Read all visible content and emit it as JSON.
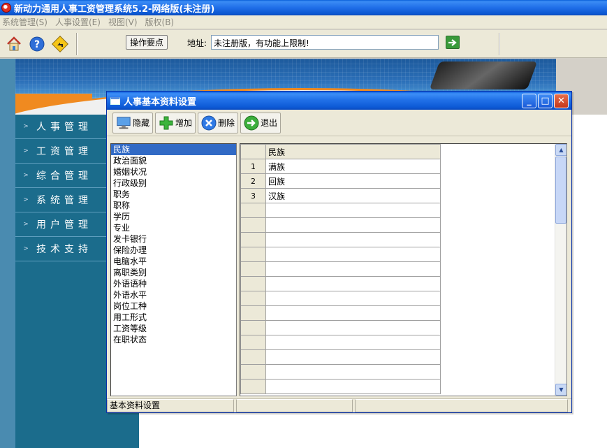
{
  "app": {
    "title": "新动力通用人事工资管理系统5.2-网络版(未注册)"
  },
  "menubar": {
    "items": [
      {
        "label": "系统管理(S)"
      },
      {
        "label": "人事设置(E)"
      },
      {
        "label": "视图(V)"
      },
      {
        "label": "版权(B)"
      }
    ]
  },
  "toolbar": {
    "tips_button": "操作要点",
    "address_label": "地址:",
    "address_value": "未注册版，有功能上限制!",
    "icons": [
      "home-icon",
      "help-icon",
      "navigate-icon",
      "go-arrow-icon"
    ]
  },
  "nav": {
    "items": [
      {
        "label": "人事管理"
      },
      {
        "label": "工资管理"
      },
      {
        "label": "综合管理"
      },
      {
        "label": "系统管理"
      },
      {
        "label": "用户管理"
      },
      {
        "label": "技术支持"
      }
    ]
  },
  "dialog": {
    "title": "人事基本资料设置",
    "buttons": {
      "hide": "隐藏",
      "add": "增加",
      "delete": "删除",
      "exit": "退出"
    },
    "categories": [
      "民族",
      "政治面貌",
      "婚姻状况",
      "行政级别",
      "职务",
      "职称",
      "学历",
      "专业",
      "发卡银行",
      "保险办理",
      "电脑水平",
      "离职类别",
      "外语语种",
      "外语水平",
      "岗位工种",
      "用工形式",
      "工资等级",
      "在职状态"
    ],
    "selected_category": "民族",
    "grid": {
      "column_header": "民族",
      "rows": [
        {
          "num": "1",
          "value": "满族"
        },
        {
          "num": "2",
          "value": "回族"
        },
        {
          "num": "3",
          "value": "汉族"
        }
      ]
    },
    "status": {
      "pane1": "基本资料设置",
      "pane2": "",
      "pane3": ""
    }
  },
  "colors": {
    "titlebar": "#0b56d0",
    "nav_bg": "#1b6c8c",
    "accent_orange": "#f08a20",
    "selection": "#316ac5"
  }
}
